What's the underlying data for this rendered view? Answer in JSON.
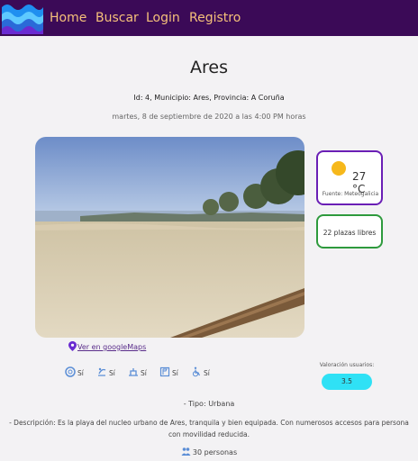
{
  "nav": {
    "home": "Home",
    "search": "Buscar",
    "login": "Login",
    "register": "Registro"
  },
  "beach": {
    "name": "Ares",
    "info": "Id: 4, Municipio: Ares, Provincia: A Coruña",
    "datetime": "martes, 8 de septiembre de 2020 a las 4:00 PM horas",
    "maps_link": "Ver en googleMaps",
    "type": "- Tipo: Urbana",
    "description_line1": "- Descripción: Es la playa del nucleo urbano de Ares, tranquila y bien equipada. Con numerosos accesos para persona",
    "description_line2": "con movilidad reducida.",
    "capacity": "30 personas"
  },
  "weather": {
    "temperature": "27 °C",
    "source": "Fuente: Meteogalicia",
    "icon": "sun-icon"
  },
  "parking": {
    "label": "22 plazas libres"
  },
  "amenities": [
    {
      "icon": "lifeguard-icon",
      "value": "Sí"
    },
    {
      "icon": "shower-icon",
      "value": "Sí"
    },
    {
      "icon": "restroom-icon",
      "value": "Sí"
    },
    {
      "icon": "flag-icon",
      "value": "Sí"
    },
    {
      "icon": "wheelchair-icon",
      "value": "Sí"
    }
  ],
  "rating": {
    "label": "Valoración usuarios:",
    "value": "3.5"
  },
  "colors": {
    "nav_bg": "#3b0a57",
    "nav_link": "#f5c07a",
    "weather_border": "#6a1fb5",
    "parking_border": "#2e9a3d",
    "rating_bg": "#2fe1f5"
  }
}
